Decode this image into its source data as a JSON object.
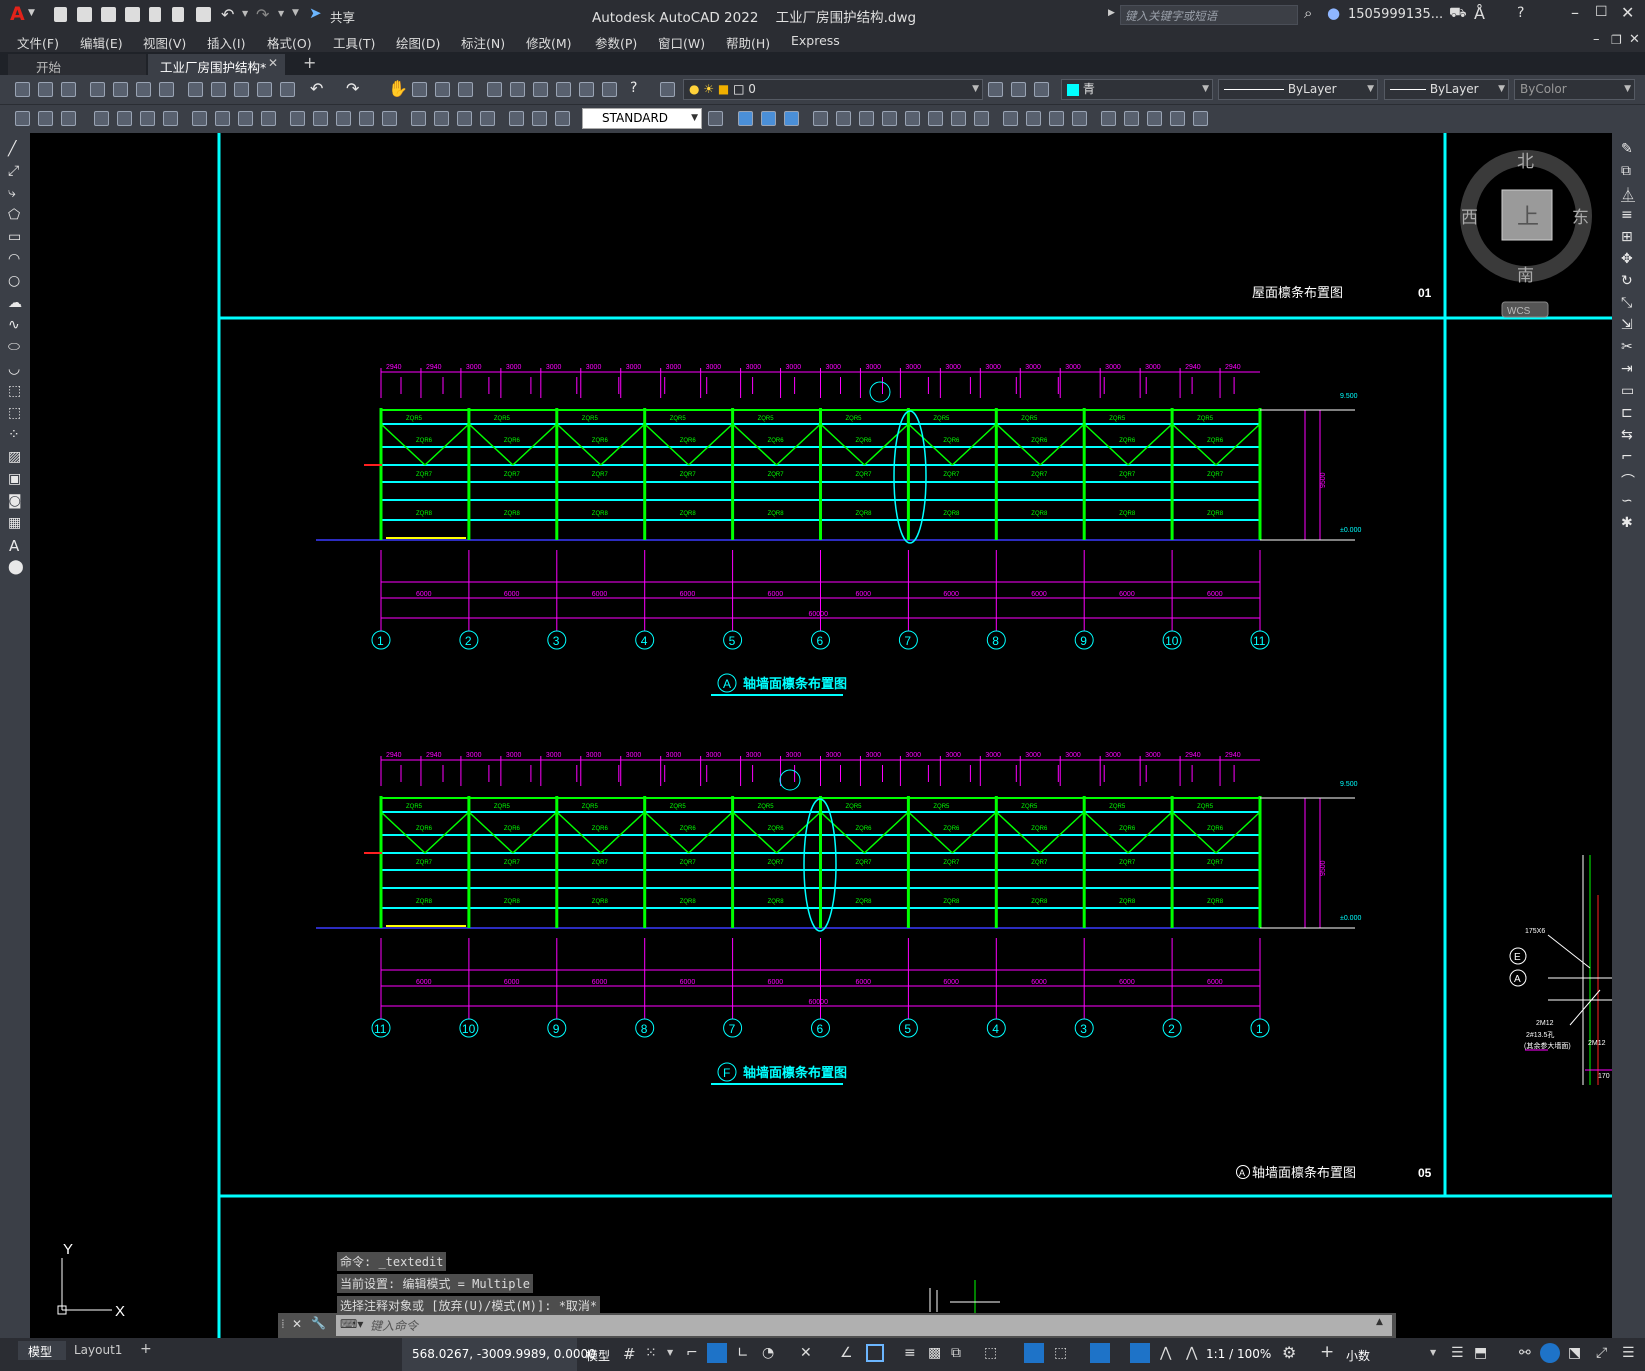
{
  "app": {
    "logo": "A",
    "title": "Autodesk AutoCAD 2022",
    "filename": "工业厂房围护结构.dwg",
    "share": "共享",
    "search_placeholder": "键入关键字或短语",
    "user": "1505999135..."
  },
  "menu": [
    "文件(F)",
    "编辑(E)",
    "视图(V)",
    "插入(I)",
    "格式(O)",
    "工具(T)",
    "绘图(D)",
    "标注(N)",
    "修改(M)",
    "参数(P)",
    "窗口(W)",
    "帮助(H)",
    "Express"
  ],
  "tabs": {
    "start": "开始",
    "active": "工业厂房围护结构*",
    "add": "+"
  },
  "toolbar": {
    "layer": "0",
    "color": "青",
    "linetype": "ByLayer",
    "lineweight": "ByLayer",
    "plotstyle": "ByColor",
    "textstyle": "STANDARD"
  },
  "viewcube": {
    "north": "北",
    "south": "南",
    "east": "东",
    "west": "西",
    "face": "上",
    "wcs": "WCS"
  },
  "drawing": {
    "top_title": "屋面檩条布置图",
    "top_num": "01",
    "bottom_title": "轴墙面檩条布置图",
    "bottom_mark": "A",
    "bottom_num": "05",
    "elev1_mark": "A",
    "elev1_title": "轴墙面檩条布置图",
    "elev2_mark": "F",
    "elev2_title": "轴墙面檩条布置图",
    "axes1": [
      "1",
      "2",
      "3",
      "4",
      "5",
      "6",
      "7",
      "8",
      "9",
      "10",
      "11"
    ],
    "axes2": [
      "11",
      "10",
      "9",
      "8",
      "7",
      "6",
      "5",
      "4",
      "3",
      "2",
      "1"
    ],
    "top_dims": [
      "2940",
      "2940",
      "3000",
      "3000",
      "3000",
      "3000",
      "3000",
      "3000",
      "3000",
      "3000",
      "3000",
      "3000",
      "3000",
      "3000",
      "3000",
      "3000",
      "3000",
      "3000",
      "3000",
      "3000",
      "2940",
      "2940"
    ],
    "bay_dims": [
      "6000",
      "6000",
      "6000",
      "6000",
      "6000",
      "6000",
      "6000",
      "6000",
      "6000",
      "6000"
    ],
    "total_dim": "60000",
    "level_top": "9.500",
    "level_zero": "±0.000",
    "height": "9500",
    "detail": {
      "e": "E",
      "a": "A",
      "t1": "175X6",
      "t2": "2M12",
      "t3": "2M12",
      "t4": "2#13.5孔",
      "t5": "(其余参大墙面)",
      "t6": "170"
    }
  },
  "ucs": {
    "y": "Y",
    "x": "X"
  },
  "command": {
    "lines": [
      "命令: _textedit",
      "当前设置: 编辑模式 = Multiple",
      "选择注释对象或 [放弃(U)/模式(M)]: *取消*"
    ],
    "placeholder": "键入命令"
  },
  "status": {
    "tab_model": "模型",
    "tab_layout": "Layout1",
    "coords": "568.0267, -3009.9989, 0.0000",
    "mode": "模型",
    "scale": "1:1 / 100%",
    "units": "小数"
  },
  "colors": {
    "cyan": "#00ffff",
    "green": "#00ff00",
    "magenta": "#ff00ff",
    "blue": "#3a3aff",
    "yellow": "#ffff00",
    "red": "#ff2020"
  }
}
